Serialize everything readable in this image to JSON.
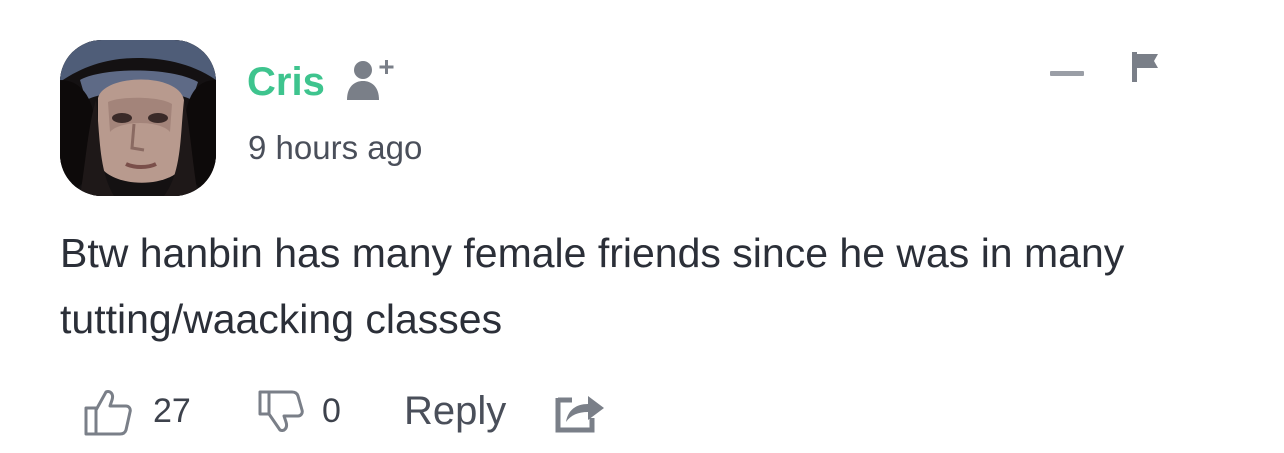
{
  "comment": {
    "author": "Cris",
    "timestamp": "9 hours ago",
    "text": "Btw hanbin has many female friends since he was in many tutting/waacking classes",
    "likes": "27",
    "dislikes": "0",
    "reply_label": "Reply"
  },
  "icons": {
    "follow": "add-user-icon",
    "collapse": "minus-icon",
    "flag": "flag-icon",
    "like": "thumbs-up-icon",
    "dislike": "thumbs-down-icon",
    "share": "share-icon"
  },
  "colors": {
    "author": "#3ec48e",
    "icon_gray": "#7a7f88",
    "text": "#2b2f38",
    "secondary": "#4a4f5a"
  }
}
